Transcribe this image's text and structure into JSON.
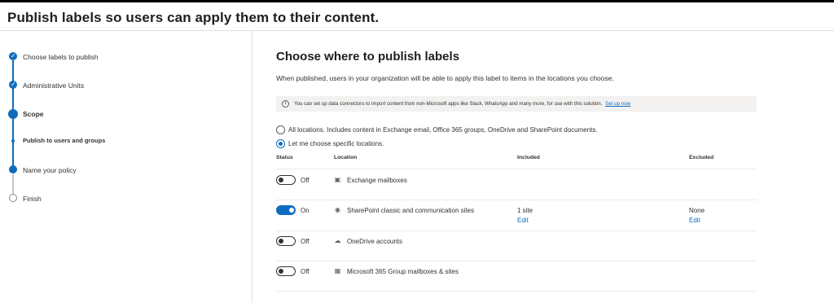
{
  "header": {
    "title": "Publish labels so users can apply them to their content."
  },
  "steps": [
    {
      "label": "Choose labels to publish",
      "state": "done"
    },
    {
      "label": "Administrative Units",
      "state": "done"
    },
    {
      "label": "Scope",
      "state": "current"
    },
    {
      "label": "Publish to users and groups",
      "state": "current-sub"
    },
    {
      "label": "Name your policy",
      "state": "upcoming-filled"
    },
    {
      "label": "Finish",
      "state": "upcoming"
    }
  ],
  "main": {
    "title": "Choose where to publish labels",
    "description": "When published, users in your organization will be able to apply this label to items in the locations you choose.",
    "banner": {
      "text": "You can set up data connectors to import content from non-Microsoft apps like Slack, WhatsApp and many more, for use with this solution.",
      "link": "Set up now"
    },
    "options": [
      {
        "label": "All locations. Includes content in Exchange email, Office 365 groups, OneDrive and SharePoint documents.",
        "selected": false
      },
      {
        "label": "Let me choose specific locations.",
        "selected": true
      }
    ],
    "columns": {
      "status": "Status",
      "location": "Location",
      "included": "Included",
      "excluded": "Excluded"
    },
    "rows": [
      {
        "status": "Off",
        "on": false,
        "icon": "exchange-icon",
        "location": "Exchange mailboxes",
        "included": "",
        "included_edit": "",
        "excluded": "",
        "excluded_edit": ""
      },
      {
        "status": "On",
        "on": true,
        "icon": "sharepoint-icon",
        "location": "SharePoint classic and communication sites",
        "included": "1 site",
        "included_edit": "Edit",
        "excluded": "None",
        "excluded_edit": "Edit"
      },
      {
        "status": "Off",
        "on": false,
        "icon": "onedrive-icon",
        "location": "OneDrive accounts",
        "included": "",
        "included_edit": "",
        "excluded": "",
        "excluded_edit": ""
      },
      {
        "status": "Off",
        "on": false,
        "icon": "microsoft-365-group-icon",
        "location": "Microsoft 365 Group mailboxes & sites",
        "included": "",
        "included_edit": "",
        "excluded": "",
        "excluded_edit": ""
      }
    ]
  },
  "colors": {
    "accent": "#0f6cbd",
    "border": "#e1dfdd",
    "banner_bg": "#f3f2f1"
  }
}
